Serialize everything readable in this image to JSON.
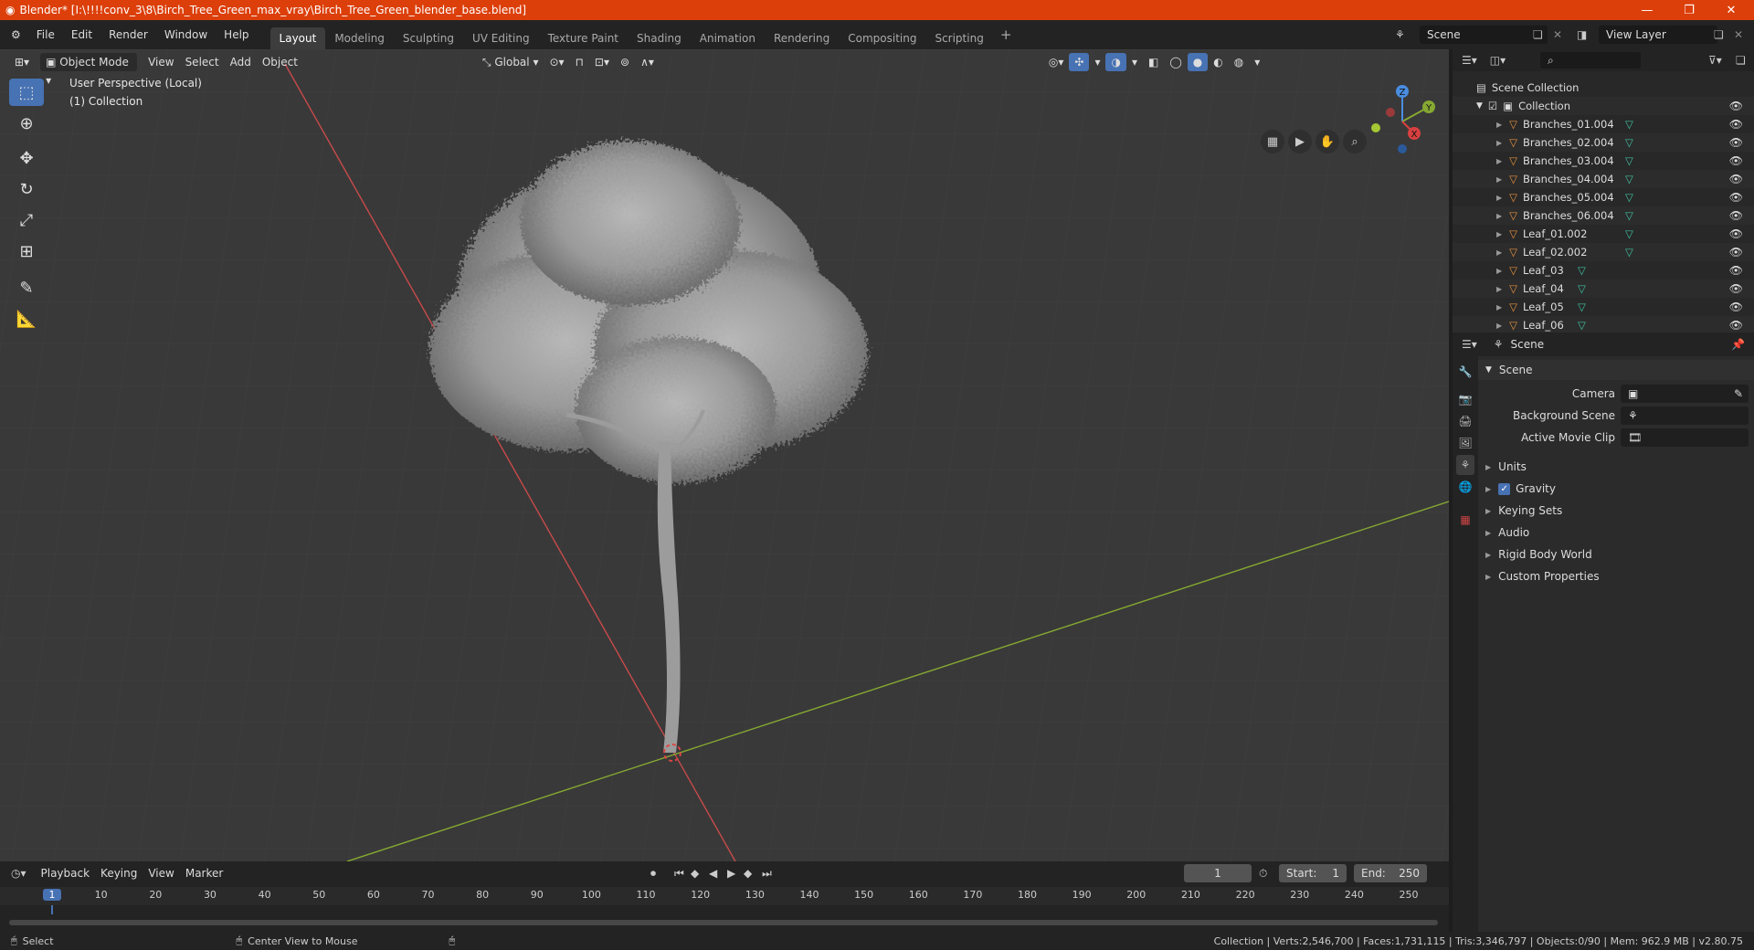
{
  "window": {
    "title": "Blender* [I:\\!!!!conv_3\\8\\Birch_Tree_Green_max_vray\\Birch_Tree_Green_blender_base.blend]"
  },
  "menus": [
    "File",
    "Edit",
    "Render",
    "Window",
    "Help"
  ],
  "workspaces": [
    "Layout",
    "Modeling",
    "Sculpting",
    "UV Editing",
    "Texture Paint",
    "Shading",
    "Animation",
    "Rendering",
    "Compositing",
    "Scripting"
  ],
  "active_workspace": "Layout",
  "scene_selector": "Scene",
  "view_layer": "View Layer",
  "viewport": {
    "mode": "Object Mode",
    "header_menus": [
      "View",
      "Select",
      "Add",
      "Object"
    ],
    "orientation": "Global",
    "overlay_line1": "User Perspective (Local)",
    "overlay_line2": "(1) Collection",
    "gizmo_labels": {
      "z": "Z",
      "y": "Y",
      "x": "X"
    }
  },
  "outliner": {
    "search_placeholder": "",
    "root": "Scene Collection",
    "collection": "Collection",
    "items": [
      "Branches_01.004",
      "Branches_02.004",
      "Branches_03.004",
      "Branches_04.004",
      "Branches_05.004",
      "Branches_06.004",
      "Leaf_01.002",
      "Leaf_02.002",
      "Leaf_03",
      "Leaf_04",
      "Leaf_05",
      "Leaf_06"
    ]
  },
  "properties": {
    "context": "Scene",
    "panel_title": "Scene",
    "camera_label": "Camera",
    "background_scene_label": "Background Scene",
    "movie_clip_label": "Active Movie Clip",
    "sections": [
      "Units",
      "Gravity",
      "Keying Sets",
      "Audio",
      "Rigid Body World",
      "Custom Properties"
    ],
    "gravity_checked": true
  },
  "timeline": {
    "menus": [
      "Playback",
      "Keying",
      "View",
      "Marker"
    ],
    "current_frame": "1",
    "start_label": "Start:",
    "start": "1",
    "end_label": "End:",
    "end": "250",
    "ruler": [
      "1",
      "10",
      "20",
      "30",
      "40",
      "50",
      "60",
      "70",
      "80",
      "90",
      "100",
      "110",
      "120",
      "130",
      "140",
      "150",
      "160",
      "170",
      "180",
      "190",
      "200",
      "210",
      "220",
      "230",
      "240",
      "250"
    ]
  },
  "statusbar": {
    "left1": "Select",
    "left2": "Center View to Mouse",
    "right": "Collection | Verts:2,546,700 | Faces:1,731,115 | Tris:3,346,797 | Objects:0/90 | Mem: 962.9 MB | v2.80.75"
  },
  "colors": {
    "accent": "#4772b3",
    "titlebar": "#dc3f0a",
    "x_axis": "#d84040",
    "y_axis": "#86a832",
    "mesh_icon": "#e8913b",
    "data_icon": "#3fc1a0"
  }
}
